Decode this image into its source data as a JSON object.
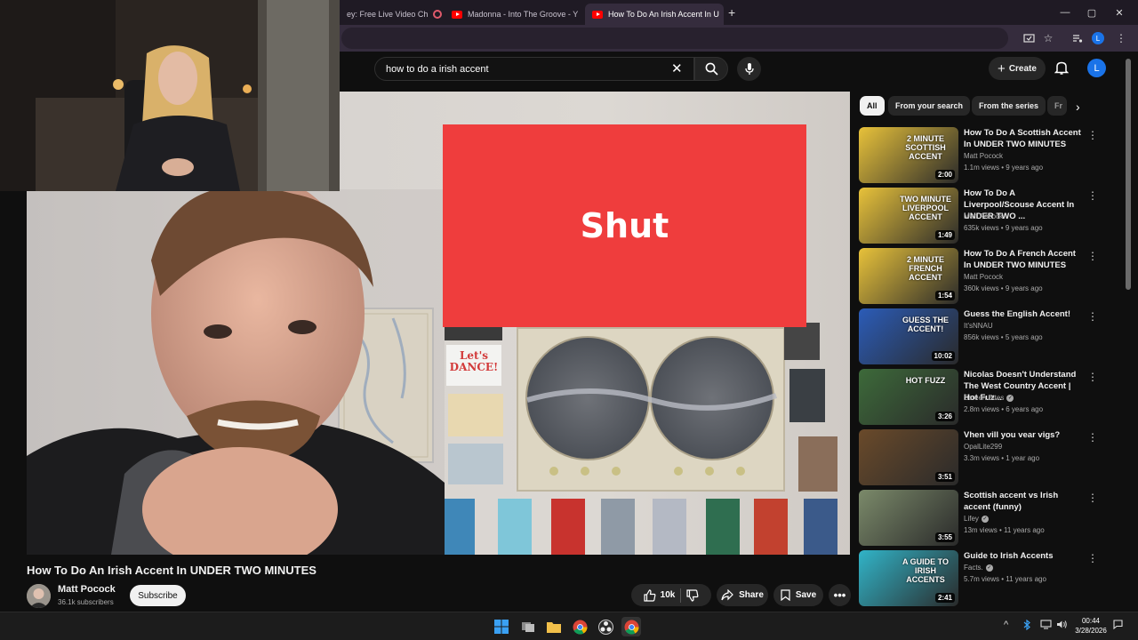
{
  "browser": {
    "tabs": [
      {
        "label": "ey: Free Live Video Ch",
        "favicon": "twitch-record-icon"
      },
      {
        "label": "Madonna - Into The Groove - Y",
        "favicon": "youtube-icon"
      },
      {
        "label": "How To Do An Irish Accent In U",
        "favicon": "youtube-icon",
        "active": true
      }
    ],
    "new_tab": "+",
    "window_controls": {
      "minimize": "—",
      "maximize": "▢",
      "close": "✕"
    },
    "profile_initial": "L"
  },
  "youtube": {
    "search": {
      "query": "how to do a irish accent"
    },
    "create_label": "Create",
    "avatar_initial": "L",
    "player": {
      "overlay_text": "Shut",
      "poster_text": "Let's DANCE!"
    },
    "video": {
      "title": "How To Do An Irish Accent In UNDER TWO MINUTES",
      "channel": "Matt Pocock",
      "subscribers": "36.1k subscribers",
      "subscribe_label": "Subscribe",
      "likes": "10k",
      "share_label": "Share",
      "save_label": "Save"
    },
    "chips": [
      "All",
      "From your search",
      "From the series",
      "Fr"
    ],
    "recommendations": [
      {
        "title": "How To Do A Scottish Accent In UNDER TWO MINUTES",
        "channel": "Matt Pocock",
        "meta": "1.1m views • 9 years ago",
        "duration": "2:00",
        "thumb_text": "2 MINUTE SCOTTISH ACCENT",
        "accent": "#e8c23a",
        "verified": false
      },
      {
        "title": "How To Do A Liverpool/Scouse Accent In UNDER TWO ...",
        "channel": "Matt Pocock",
        "meta": "635k views • 9 years ago",
        "duration": "1:49",
        "thumb_text": "TWO MINUTE LIVERPOOL ACCENT",
        "accent": "#e8c23a",
        "verified": false
      },
      {
        "title": "How To Do A French Accent In UNDER TWO MINUTES",
        "channel": "Matt Pocock",
        "meta": "360k views • 9 years ago",
        "duration": "1:54",
        "thumb_text": "2 MINUTE FRENCH ACCENT",
        "accent": "#e8c23a",
        "verified": false
      },
      {
        "title": "Guess the English Accent!",
        "channel": "It'sNNAU",
        "meta": "856k views • 5 years ago",
        "duration": "10:02",
        "thumb_text": "GUESS THE ACCENT!",
        "accent": "#2b5cb8",
        "verified": false
      },
      {
        "title": "Nicolas Doesn't Understand The West Country Accent | Hot Fuz...",
        "channel": "Screen Bites",
        "meta": "2.8m views • 6 years ago",
        "duration": "3:26",
        "thumb_text": "HOT FUZZ",
        "accent": "#3d6a3a",
        "verified": true
      },
      {
        "title": "Vhen vill you vear vigs?",
        "channel": "OpalLite299",
        "meta": "3.3m views • 1 year ago",
        "duration": "3:51",
        "thumb_text": "",
        "accent": "#6a4a2a",
        "verified": false
      },
      {
        "title": "Scottish accent vs Irish accent (funny)",
        "channel": "Lifey",
        "meta": "13m views • 11 years ago",
        "duration": "3:55",
        "thumb_text": "",
        "accent": "#7b8a6a",
        "verified": true
      },
      {
        "title": "Guide to Irish Accents",
        "channel": "Facts.",
        "meta": "5.7m views • 11 years ago",
        "duration": "2:41",
        "thumb_text": "A GUIDE TO IRISH ACCENTS",
        "accent": "#31b4c8",
        "verified": true
      }
    ]
  },
  "taskbar": {
    "time": "00:44",
    "date": "3/28/2026",
    "tray_chevron": "^"
  }
}
